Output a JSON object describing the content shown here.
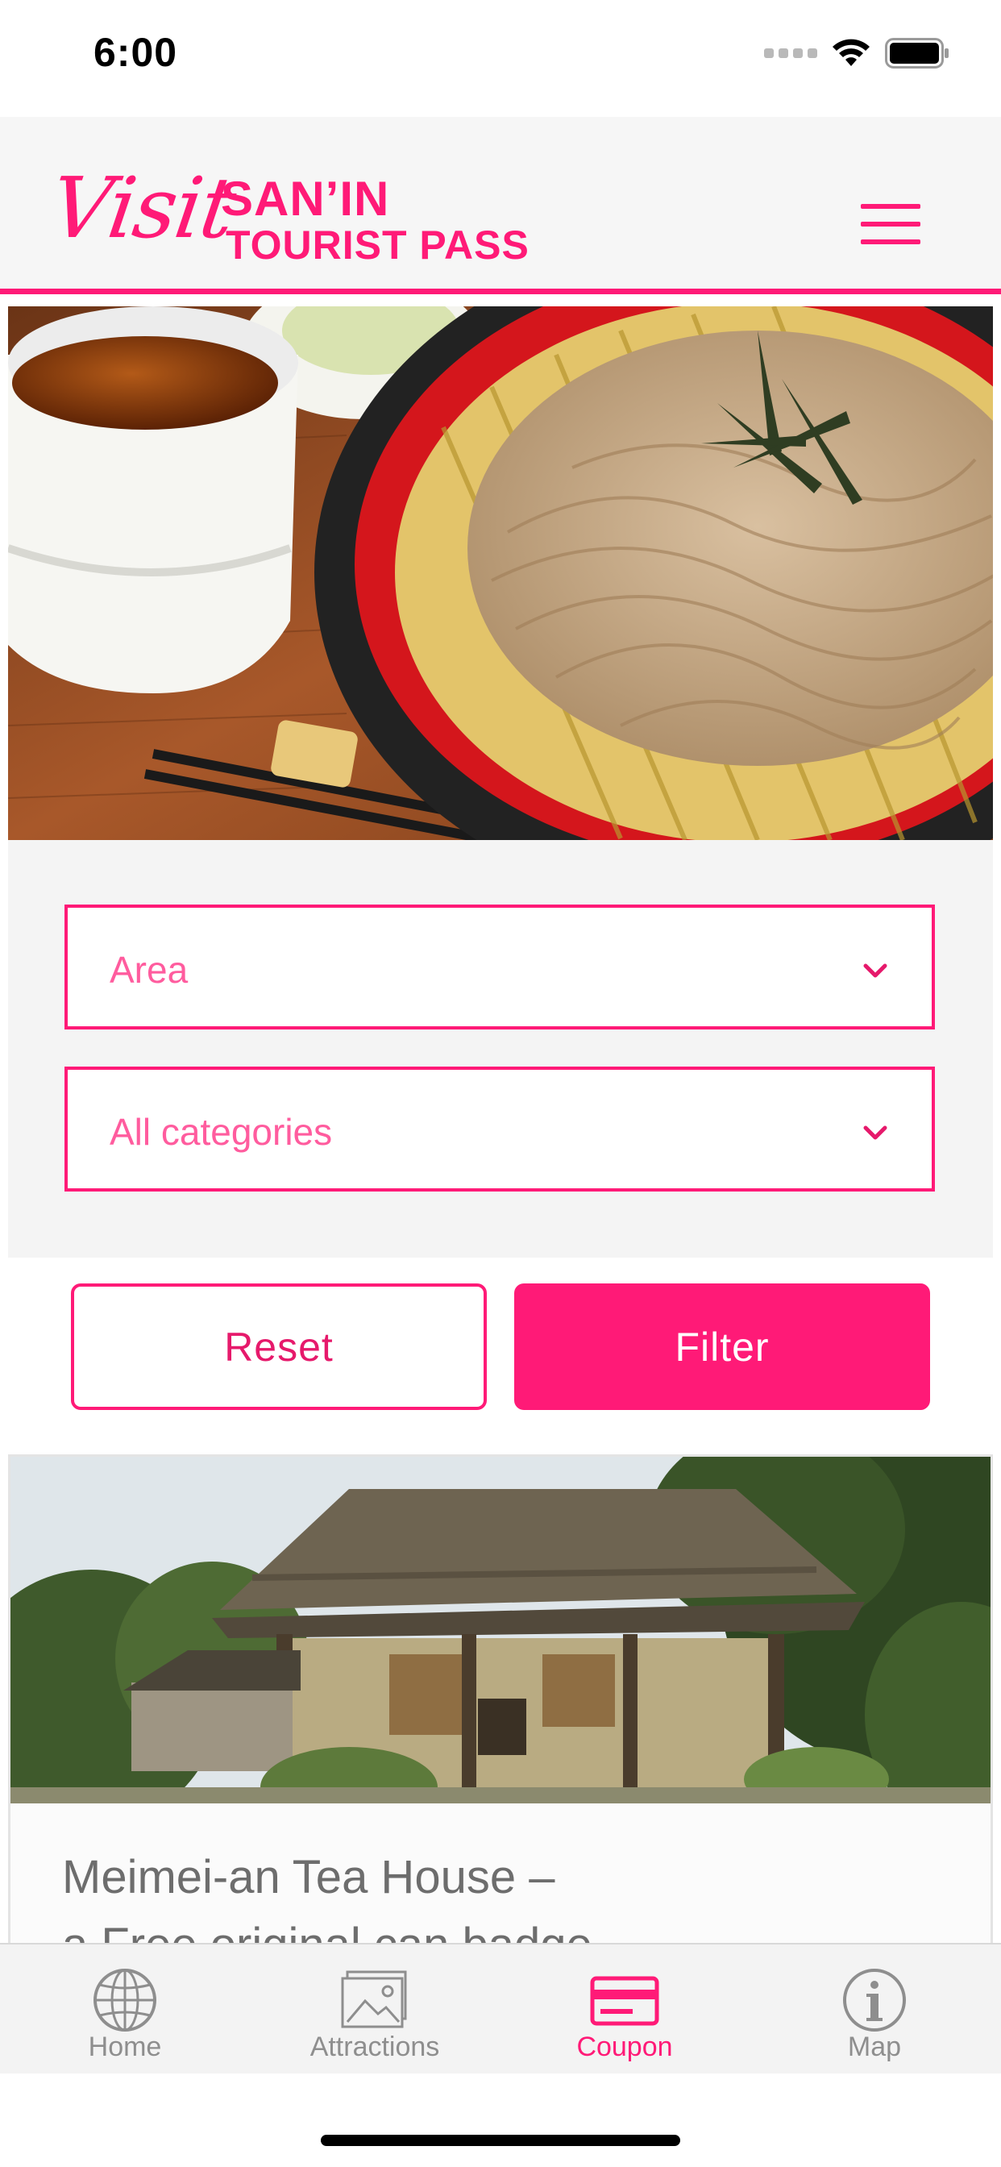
{
  "status_bar": {
    "time": "6:00"
  },
  "header": {
    "logo": {
      "script_word": "Visit",
      "line1": "SAN’IN",
      "line2": "TOURIST PASS"
    },
    "menu_icon": "hamburger-menu-icon"
  },
  "hero": {
    "image": "soba-noodles-photo"
  },
  "filters": {
    "area": {
      "selected": "Area"
    },
    "category": {
      "selected": "All categories"
    }
  },
  "actions": {
    "reset_label": "Reset",
    "filter_label": "Filter"
  },
  "coupon_card": {
    "image": "tea-house-photo",
    "title_line1": "Meimei-an Tea House –",
    "title_line2": "a Free original can badge"
  },
  "tab_bar": {
    "tabs": [
      {
        "label": "Home",
        "icon": "globe-icon",
        "active": false
      },
      {
        "label": "Attractions",
        "icon": "image-icon",
        "active": false
      },
      {
        "label": "Coupon",
        "icon": "card-icon",
        "active": true
      },
      {
        "label": "Map",
        "icon": "info-icon",
        "active": false
      }
    ]
  },
  "colors": {
    "accent": "#ff1a77",
    "tab_inactive": "#8e8e8e",
    "panel_bg": "#f4f4f4"
  }
}
